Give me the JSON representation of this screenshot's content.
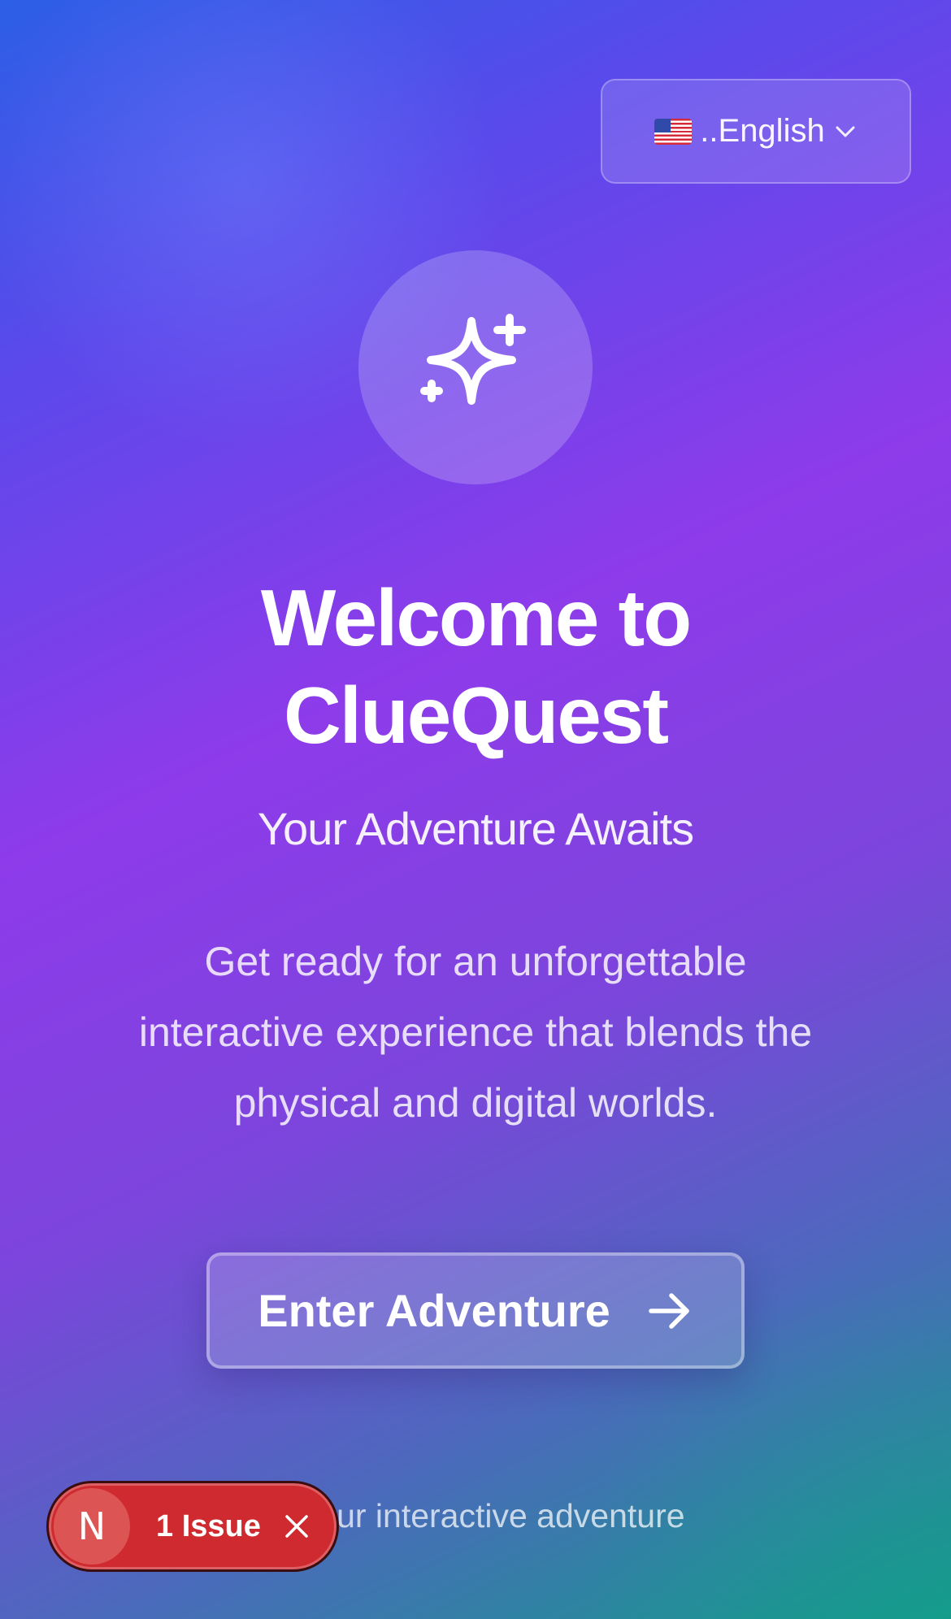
{
  "language_selector": {
    "flag": "🇺🇸",
    "label": "..English",
    "icon": "chevron-down-icon"
  },
  "hero": {
    "icon": "sparkles-icon",
    "title_line1": "Welcome to",
    "title_line2": "ClueQuest",
    "subtitle": "Your Adventure Awaits",
    "description": "Get ready for an unforgettable interactive experience that blends the physical and digital worlds."
  },
  "cta": {
    "label": "Enter Adventure",
    "icon": "arrow-right-icon"
  },
  "footer": {
    "text": "in your interactive adventure"
  },
  "dev_overlay": {
    "logo_letter": "N",
    "issues_label": "1 Issue",
    "close_icon": "close-icon",
    "color": "#cf2a2f"
  }
}
